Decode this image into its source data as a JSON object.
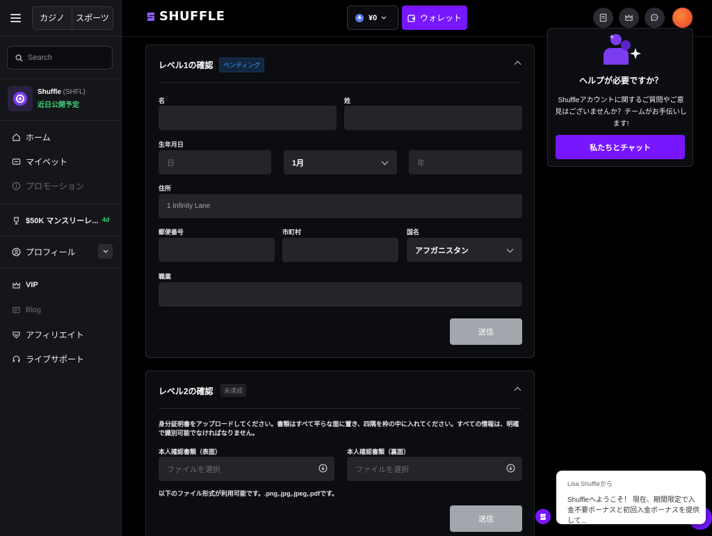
{
  "sidebar": {
    "tabs": [
      "カジノ",
      "スポーツ"
    ],
    "search_placeholder": "Search",
    "token": {
      "name": "Shuffle",
      "symbol": "(SHFL)",
      "status": "近日公開予定"
    },
    "items": [
      {
        "label": "ホーム",
        "icon": "home-icon"
      },
      {
        "label": "マイベット",
        "icon": "ticket-icon"
      },
      {
        "label": "プロモーション",
        "icon": "info-icon"
      },
      {
        "label": "$50K マンスリーレ...",
        "icon": "trophy-icon",
        "badge": "4d"
      },
      {
        "label": "プロフィール",
        "icon": "user-icon"
      },
      {
        "label": "VIP",
        "icon": "crown-icon"
      },
      {
        "label": "Blog",
        "icon": "blog-icon"
      },
      {
        "label": "アフィリエイト",
        "icon": "handshake-icon"
      },
      {
        "label": "ライブサポート",
        "icon": "headset-icon"
      }
    ]
  },
  "header": {
    "logo": "SHUFFLE",
    "balance": "¥0",
    "wallet_label": "ウォレット"
  },
  "level1": {
    "title": "レベル1の確認",
    "status": "ペンディング",
    "labels": {
      "first_name": "名",
      "last_name": "姓",
      "dob": "生年月日",
      "address": "住所",
      "postal": "郵便番号",
      "city": "市町村",
      "country": "国名",
      "occupation": "職業"
    },
    "placeholders": {
      "day": "日",
      "year": "年"
    },
    "values": {
      "month": "1月",
      "address": "1 Infinity Lane",
      "country": "アフガニスタン"
    },
    "submit": "送信"
  },
  "level2": {
    "title": "レベル2の確認",
    "status": "未達成",
    "instructions": "身分証明書をアップロードしてください。書類はすべて平らな面に置き、四隅を枠の中に入れてください。すべての情報は、明確で識別可能でなければなりません。",
    "front_label": "本人確認書類（表面）",
    "back_label": "本人確認書類（裏面）",
    "file_placeholder": "ファイルを選択",
    "formats": "以下のファイル形式が利用可能です。.png,.jpg,.jpeg,.pdfです。",
    "submit": "送信"
  },
  "help": {
    "title": "ヘルプが必要ですか？",
    "body": "Shuffleアカウントに関するご質問やご意見はございませんか？チームがお手伝いします!",
    "button": "私たちとチャット"
  },
  "chat_popup": {
    "from": "Lisa Shuffleから",
    "message": "Shuffleへようこそ！ 現在、期間限定で入金不要ボーナスと初回入金ボーナスを提供して..."
  },
  "colors": {
    "accent": "#7717ff",
    "success": "#3fd17a",
    "pending": "#3d9bff"
  }
}
